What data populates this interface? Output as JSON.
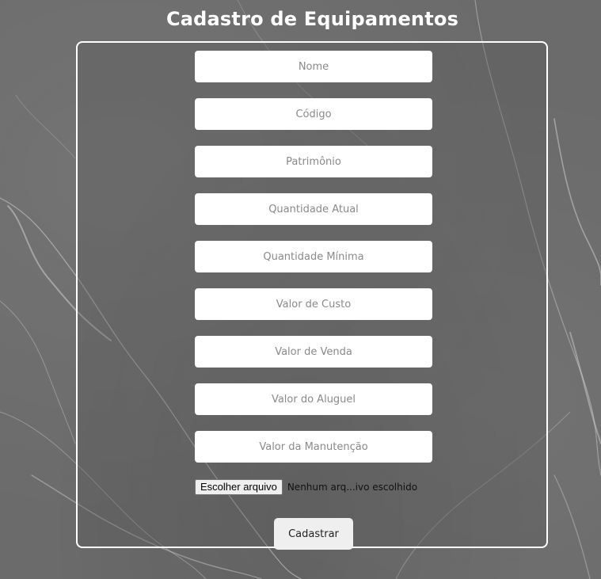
{
  "page": {
    "title": "Cadastro de Equipamentos"
  },
  "form": {
    "fields": [
      {
        "placeholder": "Nome",
        "value": ""
      },
      {
        "placeholder": "Código",
        "value": ""
      },
      {
        "placeholder": "Patrimônio",
        "value": ""
      },
      {
        "placeholder": "Quantidade Atual",
        "value": ""
      },
      {
        "placeholder": "Quantidade Mínima",
        "value": ""
      },
      {
        "placeholder": "Valor de Custo",
        "value": ""
      },
      {
        "placeholder": "Valor de Venda",
        "value": ""
      },
      {
        "placeholder": "Valor do Aluguel",
        "value": ""
      },
      {
        "placeholder": "Valor da Manutenção",
        "value": ""
      }
    ],
    "file": {
      "button_label": "Escolher arquivo",
      "status": "Nenhum arq...ivo escolhido"
    },
    "submit_label": "Cadastrar"
  },
  "colors": {
    "background": "#6b6b6b",
    "panel_border": "#ffffff",
    "field_background": "#ffffff",
    "button_background": "#efefef"
  }
}
